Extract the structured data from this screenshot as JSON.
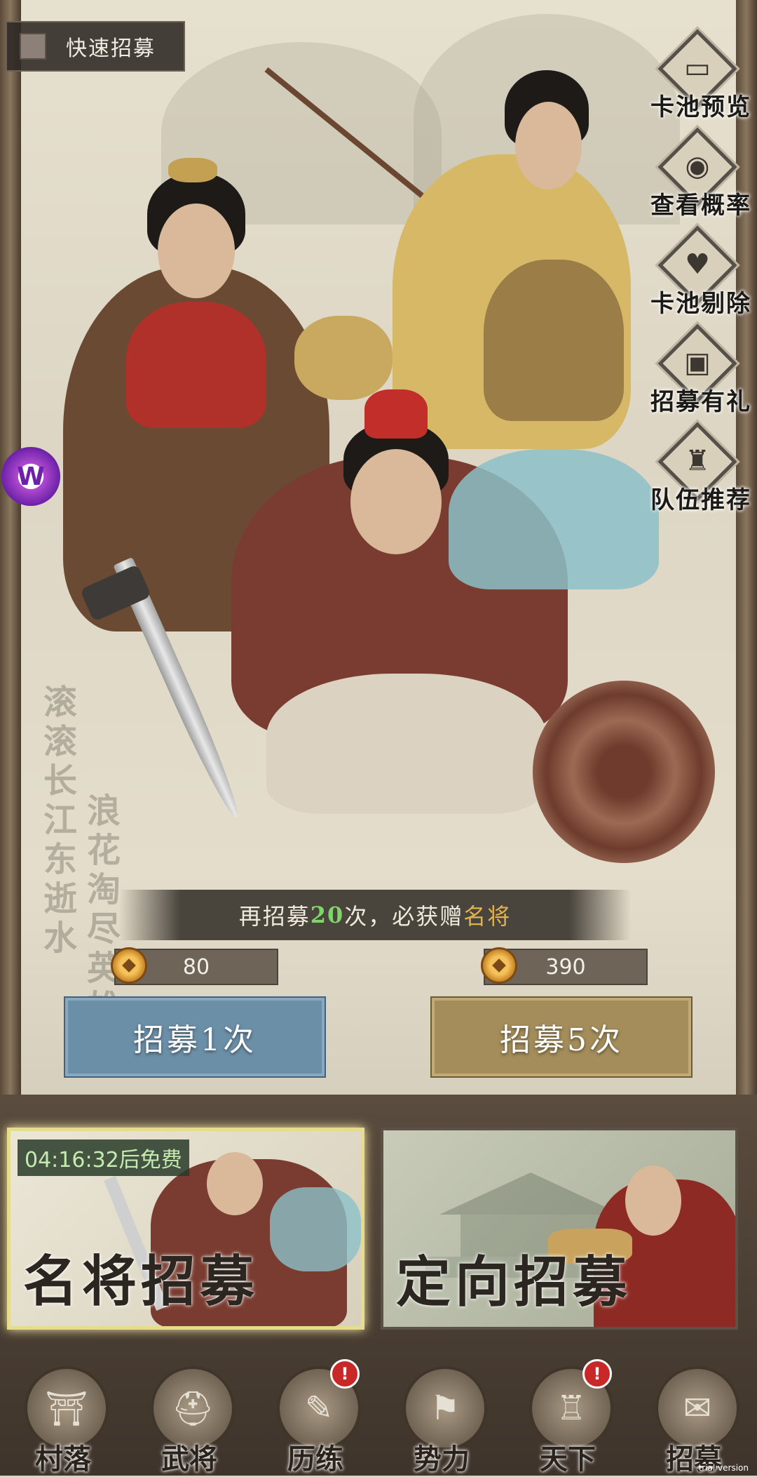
{
  "quick_recruit": {
    "label": "快速招募"
  },
  "right_menu": [
    {
      "label": "卡池预览",
      "icon": "card-pool-icon",
      "glyph": "▭"
    },
    {
      "label": "查看概率",
      "icon": "eye-icon",
      "glyph": "◉"
    },
    {
      "label": "卡池剔除",
      "icon": "heart-check-icon",
      "glyph": "♥"
    },
    {
      "label": "招募有礼",
      "icon": "gift-chest-icon",
      "glyph": "▣"
    },
    {
      "label": "队伍推荐",
      "icon": "helmet-icon",
      "glyph": "♜"
    }
  ],
  "poem": {
    "line1": "滚滚长江东逝水",
    "line2": "浪花淘尽英雄"
  },
  "banner": {
    "prefix": "再招募",
    "count": "20",
    "mid": "次，必获赠",
    "reward": "名将"
  },
  "costs": {
    "single": "80",
    "five": "390"
  },
  "buttons": {
    "single": "招募1次",
    "five": "招募5次"
  },
  "cards": [
    {
      "title": "名将招募",
      "timer": "04:16:32后免费"
    },
    {
      "title": "定向招募"
    }
  ],
  "nav": [
    {
      "label": "村落",
      "icon": "village-gate-icon",
      "glyph": "⛩"
    },
    {
      "label": "武将",
      "icon": "general-helmet-icon",
      "glyph": "⛑"
    },
    {
      "label": "历练",
      "icon": "scroll-sword-icon",
      "glyph": "✎",
      "badge": "!"
    },
    {
      "label": "势力",
      "icon": "war-map-icon",
      "glyph": "⚑"
    },
    {
      "label": "天下",
      "icon": "bronze-cauldron-icon",
      "glyph": "♖",
      "badge": "!"
    },
    {
      "label": "招募",
      "icon": "recruit-scroll-icon",
      "glyph": "✉"
    }
  ],
  "watermark": "trial version",
  "colors": {
    "accent_green": "#7fd46a",
    "accent_gold": "#e2b24f",
    "button_blue": "#6c8fa8",
    "button_gold": "#a48d5b"
  }
}
